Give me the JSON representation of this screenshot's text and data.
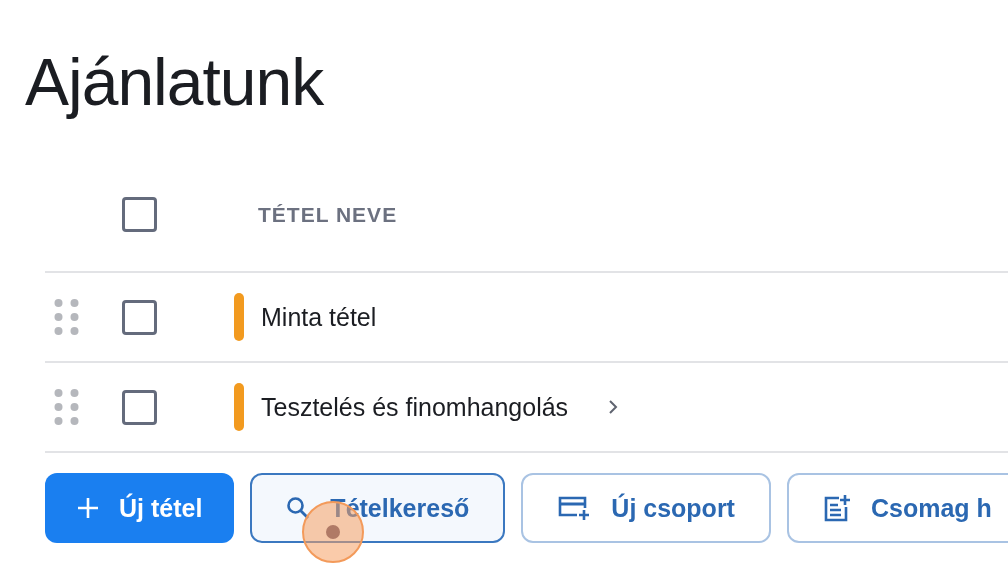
{
  "title": "Ajánlatunk",
  "table": {
    "columns": [
      {
        "label": "TÉTEL NEVE"
      }
    ],
    "header_checked": false,
    "rows": [
      {
        "name": "Minta tétel",
        "checked": false,
        "color": "#f29a1f",
        "expandable": false
      },
      {
        "name": "Tesztelés és finomhangolás",
        "checked": false,
        "color": "#f29a1f",
        "expandable": true
      }
    ]
  },
  "buttons": [
    {
      "kind": "primary",
      "label": "Új tétel",
      "highlighted": false,
      "clicked": false
    },
    {
      "kind": "outline",
      "label": "Tételkereső",
      "highlighted": true,
      "clicked": true
    },
    {
      "kind": "outline",
      "label": "Új csoport",
      "highlighted": false,
      "clicked": false
    },
    {
      "kind": "outline",
      "label": "Csomag h",
      "highlighted": false,
      "clicked": false
    }
  ]
}
